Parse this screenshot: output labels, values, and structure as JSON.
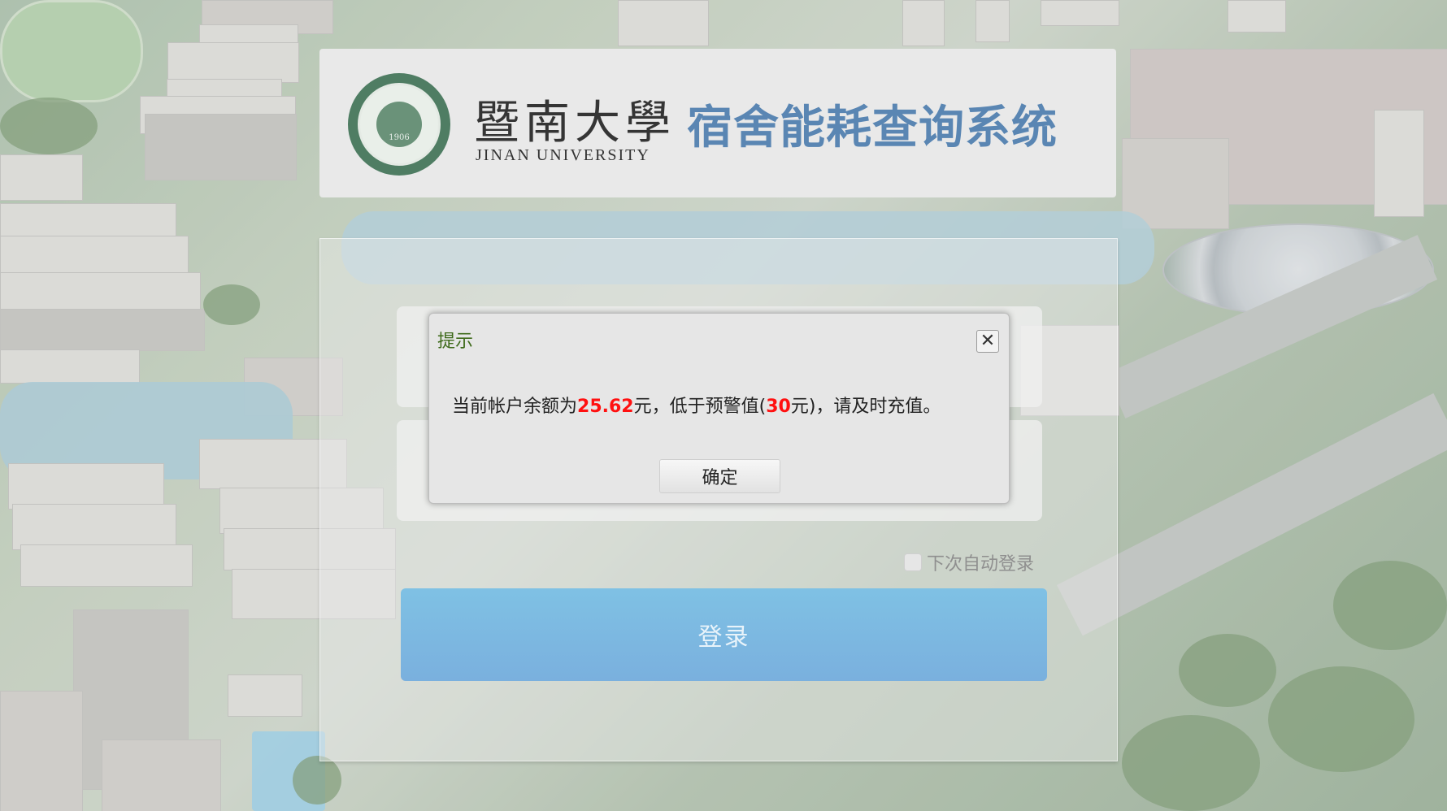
{
  "header": {
    "university_cn": "暨南大學",
    "university_en": "JINAN UNIVERSITY",
    "logo_year": "1906",
    "system_title": "宿舍能耗查询系统"
  },
  "login": {
    "remember_label": "下次自动登录",
    "login_button": "登录"
  },
  "dialog": {
    "title": "提示",
    "close_icon": "close-icon",
    "message_prefix": "当前帐户余额为",
    "balance": "25.62",
    "message_mid1": "元，低于预警值(",
    "threshold": "30",
    "message_mid2": "元)，请及时充值。",
    "ok_button": "确定"
  },
  "colors": {
    "title_blue": "#5a86b3",
    "login_button": "#7ab0de",
    "highlight_red": "#ff1010",
    "dialog_title_green": "#3e6a1a"
  }
}
